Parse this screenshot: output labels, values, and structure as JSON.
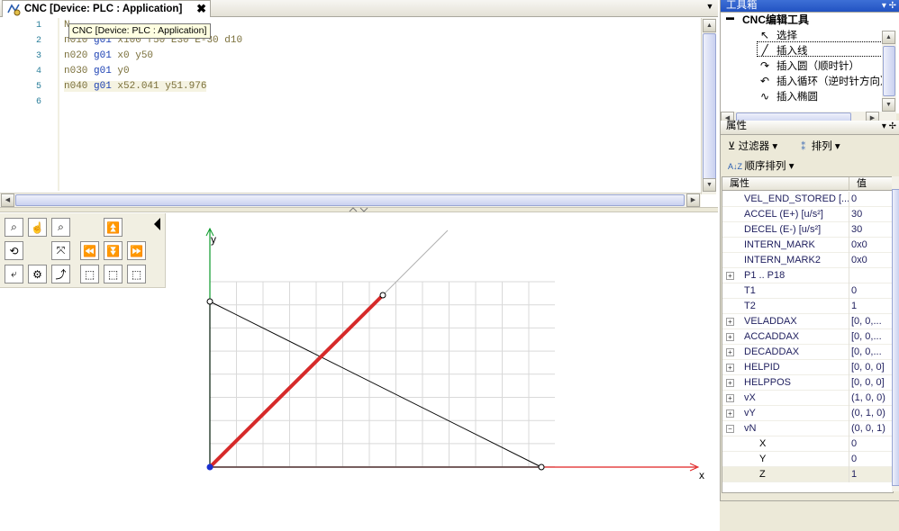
{
  "tab": {
    "title": "CNC [Device: PLC : Application]",
    "close": "✖"
  },
  "tooltip": "CNC [Device: PLC : Application]",
  "editor": {
    "line_numbers": [
      "1",
      "2",
      "3",
      "4",
      "5",
      "6"
    ],
    "lines": [
      [
        {
          "t": "N",
          "k": 0
        }
      ],
      [
        {
          "t": "n010 ",
          "k": 0
        },
        {
          "t": "g01",
          "k": 1
        },
        {
          "t": " x100 f50 E30 E-30 d10",
          "k": 0
        }
      ],
      [
        {
          "t": "n020 ",
          "k": 0
        },
        {
          "t": "g01",
          "k": 1
        },
        {
          "t": " x0 y50",
          "k": 0
        }
      ],
      [
        {
          "t": "n030 ",
          "k": 0
        },
        {
          "t": "g01",
          "k": 1
        },
        {
          "t": " y0",
          "k": 0
        }
      ],
      [
        {
          "t": "n040 ",
          "k": 0
        },
        {
          "t": "g01",
          "k": 1
        },
        {
          "t": " x52.041 y51.976",
          "k": 0
        }
      ],
      []
    ]
  },
  "graph": {
    "x_axis_label": "x",
    "y_axis_label": "y"
  },
  "graph_tools": [
    {
      "name": "zoom-in-icon",
      "glyph": "⌕"
    },
    {
      "name": "pan-icon",
      "glyph": "☝"
    },
    {
      "name": "zoom-out-icon",
      "glyph": "⌕"
    },
    {
      "name": "step-up-icon",
      "glyph": "⏫"
    },
    {
      "name": "rotate-icon",
      "glyph": "⟲"
    },
    {
      "name": "move-icon",
      "glyph": "⤧"
    },
    {
      "name": "step-back-icon",
      "glyph": "⏪"
    },
    {
      "name": "step-down-icon",
      "glyph": "⏬"
    },
    {
      "name": "step-forward-icon",
      "glyph": "⏩"
    },
    {
      "name": "path-icon",
      "glyph": "⤶"
    },
    {
      "name": "tool-icon",
      "glyph": "⚙"
    },
    {
      "name": "curve-icon",
      "glyph": "⤴"
    },
    {
      "name": "view-xy-icon",
      "glyph": "⬚"
    },
    {
      "name": "view-xz-icon",
      "glyph": "⬚"
    },
    {
      "name": "view-yz-icon",
      "glyph": "⬚"
    }
  ],
  "toolbox": {
    "header": "工具箱",
    "group": "CNC编辑工具",
    "items": [
      {
        "label": "选择",
        "glyph": "↖"
      },
      {
        "label": "插入线",
        "glyph": "╱"
      },
      {
        "label": "插入圆（顺时针）",
        "glyph": "↷"
      },
      {
        "label": "插入循环（逆时针方向）",
        "glyph": "↶"
      },
      {
        "label": "插入椭圆",
        "glyph": "∿"
      }
    ]
  },
  "properties": {
    "header": "属性",
    "filter_label": "过滤器",
    "sort_label": "排列",
    "order_label": "顺序排列",
    "col_property": "属性",
    "col_value": "值",
    "rows": [
      {
        "name": "VEL_END_STORED [...",
        "value": "0",
        "exp": ""
      },
      {
        "name": "ACCEL (E+) [u/s²]",
        "value": "30",
        "exp": ""
      },
      {
        "name": "DECEL (E-) [u/s²]",
        "value": "30",
        "exp": ""
      },
      {
        "name": "INTERN_MARK",
        "value": "0x0",
        "exp": ""
      },
      {
        "name": "INTERN_MARK2",
        "value": "0x0",
        "exp": ""
      },
      {
        "name": "P1 .. P18",
        "value": "",
        "exp": "+"
      },
      {
        "name": "T1",
        "value": "0",
        "exp": ""
      },
      {
        "name": "T2",
        "value": "1",
        "exp": ""
      },
      {
        "name": "VELADDAX",
        "value": "[0, 0,...",
        "exp": "+"
      },
      {
        "name": "ACCADDAX",
        "value": "[0, 0,...",
        "exp": "+"
      },
      {
        "name": "DECADDAX",
        "value": "[0, 0,...",
        "exp": "+"
      },
      {
        "name": "HELPID",
        "value": "[0, 0, 0]",
        "exp": "+"
      },
      {
        "name": "HELPPOS",
        "value": "[0, 0, 0]",
        "exp": "+"
      },
      {
        "name": "vX",
        "value": "(1, 0, 0)",
        "exp": "+"
      },
      {
        "name": "vY",
        "value": "(0, 1, 0)",
        "exp": "+"
      },
      {
        "name": "vN",
        "value": "(0, 0, 1)",
        "exp": "−"
      }
    ],
    "sub_rows": [
      {
        "name": "X",
        "value": "0"
      },
      {
        "name": "Y",
        "value": "0"
      },
      {
        "name": "Z",
        "value": "1"
      }
    ]
  }
}
